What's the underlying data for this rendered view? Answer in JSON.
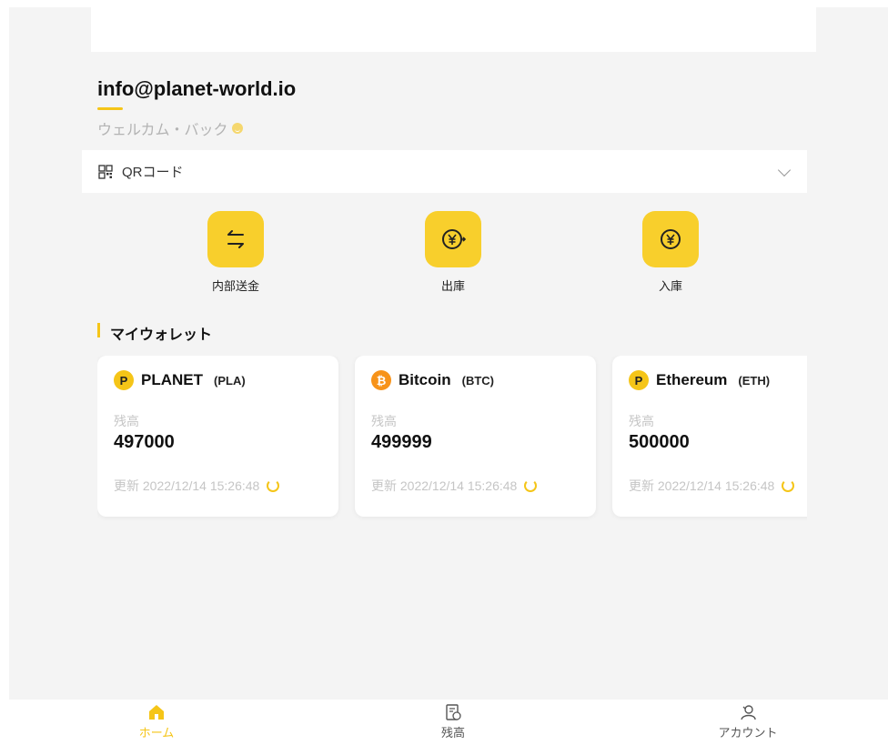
{
  "header": {
    "email": "info@planet-world.io",
    "welcome": "ウェルカム・バック"
  },
  "qr": {
    "label": "QRコード"
  },
  "actions": [
    {
      "label": "内部送金",
      "icon": "transfer-arrows-icon"
    },
    {
      "label": "出庫",
      "icon": "yen-withdraw-icon"
    },
    {
      "label": "入庫",
      "icon": "yen-deposit-icon"
    }
  ],
  "wallet": {
    "title": "マイウォレット",
    "cards": [
      {
        "name": "PLANET",
        "symbol": "(PLA)",
        "balance_label": "残高",
        "balance": "497000",
        "updated": "更新 2022/12/14 15:26:48",
        "logo": "P",
        "color": "#f5c518"
      },
      {
        "name": "Bitcoin",
        "symbol": "(BTC)",
        "balance_label": "残高",
        "balance": "499999",
        "updated": "更新 2022/12/14 15:26:48",
        "logo": "₿",
        "color": "#f7931a"
      },
      {
        "name": "Ethereum",
        "symbol": "(ETH)",
        "balance_label": "残高",
        "balance": "500000",
        "updated": "更新 2022/12/14 15:26:48",
        "logo": "P",
        "color": "#f5c518"
      }
    ]
  },
  "nav": [
    {
      "label": "ホーム",
      "icon": "home-icon",
      "active": true
    },
    {
      "label": "残高",
      "icon": "balance-icon",
      "active": false
    },
    {
      "label": "アカウント",
      "icon": "account-icon",
      "active": false
    }
  ],
  "colors": {
    "accent": "#f5c518",
    "button": "#f8cf2c",
    "muted": "#c5c5c5"
  }
}
